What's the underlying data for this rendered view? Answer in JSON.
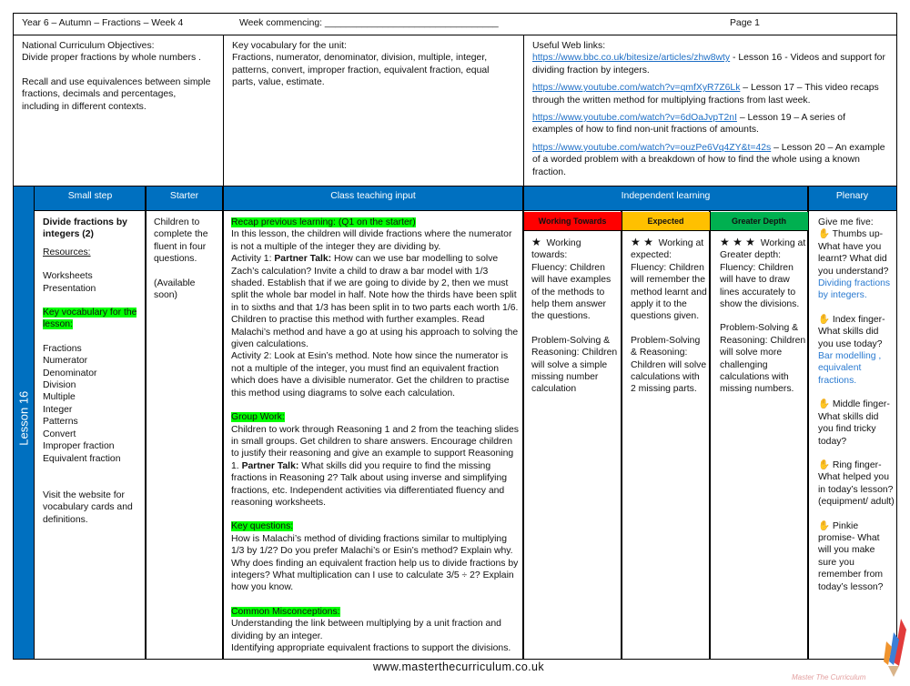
{
  "header": {
    "title": "Year 6 – Autumn – Fractions – Week 4",
    "week_commencing": "Week commencing: _________________________________",
    "page": "Page 1"
  },
  "objectives": {
    "heading": "National Curriculum Objectives:",
    "items": [
      "Divide proper fractions by whole numbers .",
      "Recall and use equivalences between simple fractions, decimals and percentages, including in different contexts."
    ]
  },
  "vocab_unit": {
    "heading": "Key vocabulary for the unit:",
    "text": "Fractions, numerator, denominator, division, multiple, integer, patterns, convert, improper fraction, equivalent fraction, equal parts, value, estimate."
  },
  "links": {
    "heading": "Useful Web links:",
    "items": [
      {
        "url": "https://www.bbc.co.uk/bitesize/articles/zhw8wty",
        "desc": " - Lesson 16 - Videos and support for dividing fraction by integers."
      },
      {
        "url": "https://www.youtube.com/watch?v=qmfXyR7Z6Lk",
        "desc": " – Lesson 17 – This video recaps through the written method for multiplying fractions from last week."
      },
      {
        "url": "https://www.youtube.com/watch?v=6dOaJvpT2nI",
        "desc": " – Lesson 19 – A series of examples of how to find non-unit fractions of amounts."
      },
      {
        "url": "https://www.youtube.com/watch?v=ouzPe6Vq4ZY&t=42s",
        "desc": " – Lesson 20 – An example of a worded problem with a breakdown of how to find the whole using a known fraction."
      }
    ]
  },
  "table": {
    "lesson": "Lesson 16",
    "headers": {
      "small_step": "Small step",
      "starter": "Starter",
      "class_teaching": "Class teaching input",
      "independent": "Independent learning",
      "plenary": "Plenary"
    },
    "levels": [
      {
        "label": "Working Towards",
        "color": "#ff0000"
      },
      {
        "label": "Expected",
        "color": "#ffc000"
      },
      {
        "label": "Greater Depth",
        "color": "#00b050"
      }
    ],
    "small_step": {
      "title": "Divide fractions by integers (2)",
      "resources_heading": "Resources:",
      "resources": [
        "Worksheets",
        "Presentation"
      ],
      "vocab_heading": "Key vocabulary for the lesson:",
      "vocab": [
        "Fractions",
        "Numerator",
        "Denominator",
        "Division",
        "Multiple",
        "Integer",
        "Patterns",
        "Convert",
        "Improper fraction",
        "Equivalent fraction"
      ],
      "visit": "Visit the website for vocabulary cards and definitions."
    },
    "starter": {
      "text": "Children to complete the fluent in four questions.",
      "note": "(Available soon)"
    },
    "teaching": {
      "recap_heading": "Recap previous learning: (Q1 on the starter)",
      "intro": "In this lesson, the children will divide fractions where the numerator is not a multiple of the integer they are dividing by.",
      "a1_prefix": "Activity 1: ",
      "a1_bold": "Partner Talk:",
      "a1_text": " How can we use bar modelling to solve Zach’s calculation? Invite a child to draw a bar model with 1/3 shaded. Establish that if we are going to divide by 2, then we must split the whole bar model in half. Note how the thirds have been split in to sixths and that 1/3 has been split in to two parts each worth 1/6. Children to practise this method with further examples. Read Malachi’s method and have a go at using his approach to solving the given calculations.",
      "a2": "Activity 2:  Look at Esin’s method. Note how since the numerator is not a multiple of the integer, you must find an equivalent fraction which does have a divisible numerator.  Get the children to practise this method using diagrams to solve each calculation.",
      "group_heading": "Group Work:",
      "group_a": "Children to work through Reasoning 1 and 2 from the teaching slides in small groups. Get children to share answers. Encourage children to justify their reasoning and give an example to support Reasoning 1. ",
      "group_bold": "Partner Talk:",
      "group_b": " What skills did you require to find the missing fractions in Reasoning 2? Talk about using inverse and simplifying fractions, etc. Independent activities via differentiated fluency and reasoning worksheets.",
      "kq_heading": "Key questions:",
      "kq": "How is Malachi’s method of dividing fractions similar to multiplying 1/3 by 1/2? Do you prefer Malachi’s or Esin’s method? Explain why. Why does finding an equivalent fraction help us to divide fractions by integers? What multiplication can I use to calculate 3/5 ÷ 2? Explain how you know.",
      "mis_heading": "Common Misconceptions:",
      "mis": [
        "Understanding the link between multiplying by a unit fraction and dividing by an integer.",
        "Identifying appropriate equivalent fractions to support the divisions."
      ]
    },
    "independent": [
      {
        "stars": "★",
        "intro": "Working towards:",
        "fluency": "Fluency: Children will have examples of the methods to help them answer the questions.",
        "ps": "Problem-Solving & Reasoning: Children will solve a simple missing number calculation"
      },
      {
        "stars": "★ ★",
        "intro": "Working at expected:",
        "fluency": "Fluency: Children will remember the method learnt and apply it to the questions given.",
        "ps": "Problem-Solving & Reasoning: Children will solve calculations with 2 missing parts."
      },
      {
        "stars": "★ ★ ★",
        "intro": "Working at Greater depth:",
        "fluency": "Fluency: Children will have to draw lines accurately to show the divisions.",
        "ps": "Problem-Solving & Reasoning: Children will solve more challenging calculations with missing numbers."
      }
    ],
    "plenary": {
      "intro": "Give me five:",
      "items": [
        {
          "text": "Thumbs up- What have you learnt? What did you understand?",
          "answer": "Dividing fractions by integers."
        },
        {
          "text": "Index finger- What skills did you use today?",
          "answer": "Bar modelling , equivalent fractions."
        },
        {
          "text": "Middle finger- What skills did you find tricky today?",
          "answer": ""
        },
        {
          "text": "Ring finger- What helped you in today’s lesson? (equipment/ adult)",
          "answer": ""
        },
        {
          "text": "Pinkie promise- What will you make sure you remember from today’s lesson?",
          "answer": ""
        }
      ]
    }
  },
  "footer": {
    "website": "www.masterthecurriculum.co.uk",
    "logo_text": "Master The Curriculum"
  }
}
